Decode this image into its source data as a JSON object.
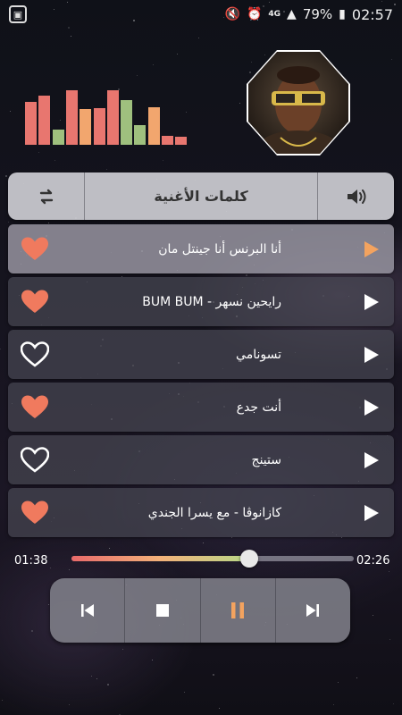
{
  "status_bar": {
    "battery": "79%",
    "time": "02:57",
    "network": "4G"
  },
  "equalizer": {
    "levels": [
      0.72,
      0.83,
      0.25,
      0.92,
      0.6,
      0.62,
      0.92,
      0.75,
      0.33,
      0.63,
      0.15,
      0.13
    ],
    "colors": [
      "#e8766f",
      "#e8766f",
      "#9fc07e",
      "#e8766f",
      "#f2a66e",
      "#e8766f",
      "#e8766f",
      "#9fc07e",
      "#9fc07e",
      "#f2a66e",
      "#e8766f",
      "#e8766f"
    ]
  },
  "header": {
    "title": "كلمات الأغنية",
    "left_icon": "repeat-icon",
    "right_icon": "volume-icon"
  },
  "songs": [
    {
      "title": "أنا البرنس أنا جينتل مان",
      "favorite": true,
      "active": true
    },
    {
      "title": "رايحين نسهر - BUM BUM",
      "favorite": true,
      "active": false
    },
    {
      "title": "تسونامي",
      "favorite": false,
      "active": false
    },
    {
      "title": "أنت جدع",
      "favorite": true,
      "active": false
    },
    {
      "title": "ستينج",
      "favorite": false,
      "active": false
    },
    {
      "title": "كازانوڤا - مع يسرا الجندي",
      "favorite": true,
      "active": false
    }
  ],
  "player": {
    "elapsed": "01:38",
    "total": "02:26",
    "progress": 0.63
  },
  "colors": {
    "accent": "#f3a35f",
    "heart": "#f07a5e"
  },
  "controls": [
    "previous-icon",
    "stop-icon",
    "pause-icon",
    "next-icon"
  ]
}
